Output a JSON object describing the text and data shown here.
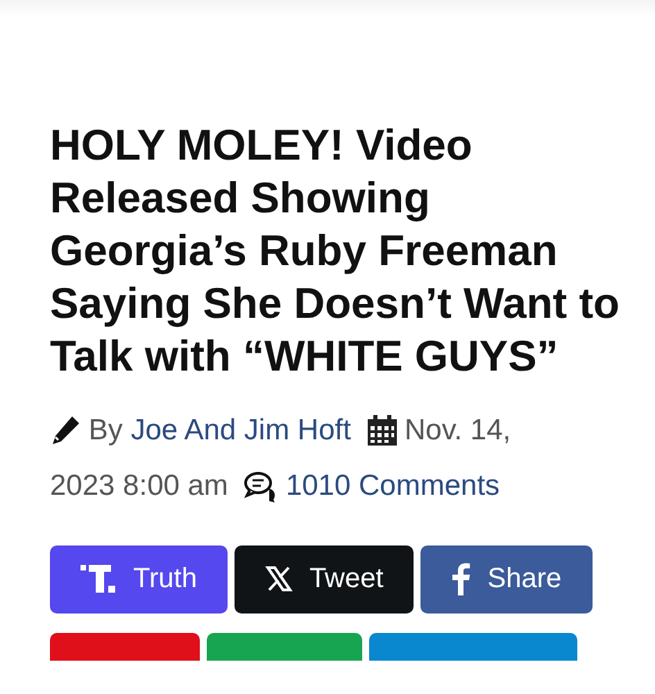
{
  "article": {
    "title": "HOLY MOLEY! Video Released Showing Georgia’s Ruby Freeman Saying She Doesn’t Want to Talk with “WHITE GUYS”",
    "byline": {
      "prefix": "By",
      "author": "Joe And Jim Hoft",
      "date_parts": [
        "Nov. 14,",
        "2023 8:00 am"
      ],
      "comments": "1010 Comments"
    }
  },
  "share_buttons": [
    {
      "kind": "truth",
      "label": "Truth",
      "color": "#5448ee"
    },
    {
      "kind": "x",
      "label": "Tweet",
      "color": "#111416"
    },
    {
      "kind": "facebook",
      "label": "Share",
      "color": "#3b5b9a"
    }
  ],
  "more_share_buttons": [
    {
      "color": "#e0101a"
    },
    {
      "color": "#17a552"
    },
    {
      "color": "#0a88cf"
    }
  ]
}
